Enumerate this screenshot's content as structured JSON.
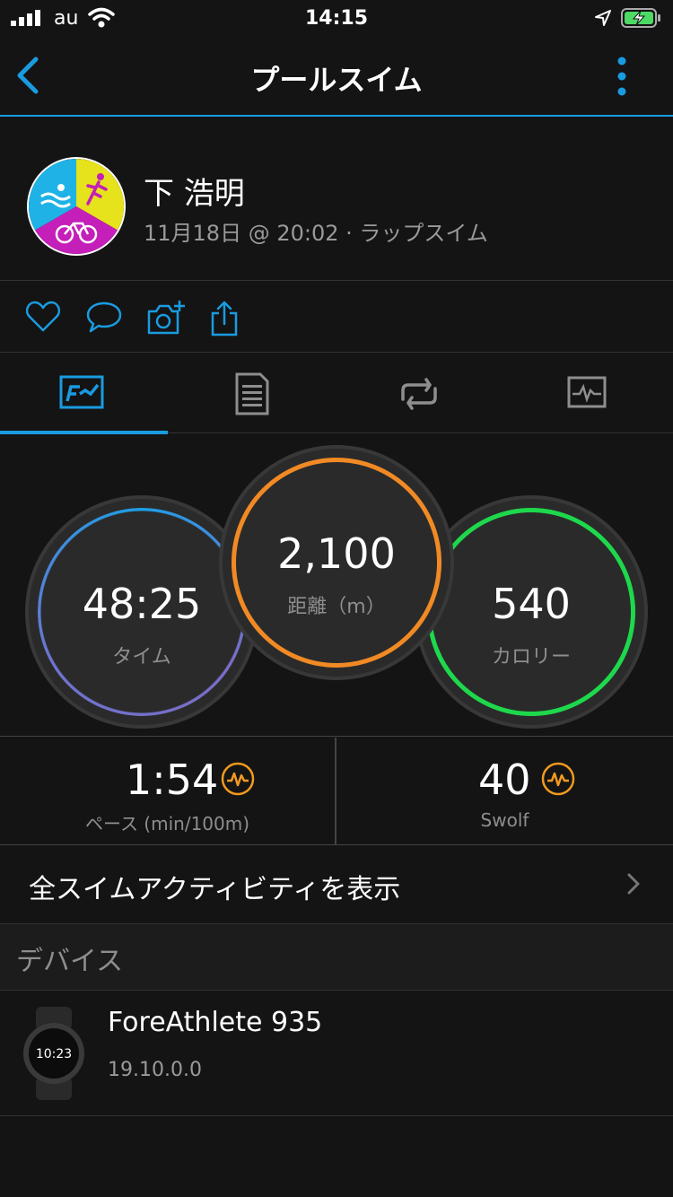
{
  "status_bar": {
    "carrier": "au",
    "time": "14:15"
  },
  "nav": {
    "title": "プールスイム"
  },
  "profile": {
    "name": "下 浩明",
    "meta": "11月18日 @ 20:02 · ラップスイム"
  },
  "metrics": {
    "time": {
      "value": "48:25",
      "label": "タイム"
    },
    "distance": {
      "value": "2,100",
      "label": "距離（m）"
    },
    "calories": {
      "value": "540",
      "label": "カロリー"
    }
  },
  "stats": {
    "pace": {
      "value": "1:54",
      "label": "ペース (min/100m)"
    },
    "swolf": {
      "value": "40",
      "label": "Swolf"
    }
  },
  "link_row": {
    "label": "全スイムアクティビティを表示"
  },
  "section": {
    "title": "デバイス"
  },
  "device": {
    "name": "ForeAthlete 935",
    "version": "19.10.0.0",
    "watch_face_time": "10:23"
  },
  "colors": {
    "accent": "#1a9be0",
    "time_ring": "#1e9ee6",
    "distance_ring": "#f18a24",
    "calories_ring": "#1ed84c",
    "chart_icon": "#f29a1e"
  }
}
